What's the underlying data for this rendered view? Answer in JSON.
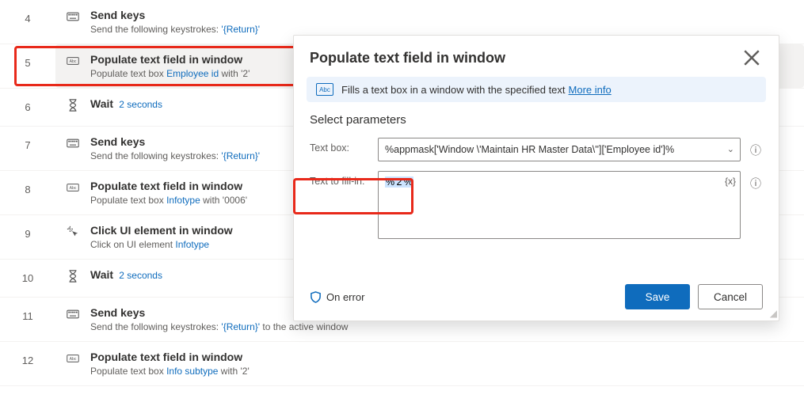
{
  "steps": [
    {
      "n": "4",
      "icon": "keyboard",
      "title": "Send keys",
      "sub_pre": "Send the following keystrokes: ",
      "sub_link": "'{Return}'",
      "sub_post": ""
    },
    {
      "n": "5",
      "icon": "abc",
      "title": "Populate text field in window",
      "sub_pre": "Populate text box ",
      "sub_link": "Employee id",
      "sub_post": " with '2'",
      "selected": true
    },
    {
      "n": "6",
      "icon": "hourglass",
      "title": "Wait",
      "inline_link": "2 seconds"
    },
    {
      "n": "7",
      "icon": "keyboard",
      "title": "Send keys",
      "sub_pre": "Send the following keystrokes: ",
      "sub_link": "'{Return}'",
      "sub_post": ""
    },
    {
      "n": "8",
      "icon": "abc",
      "title": "Populate text field in window",
      "sub_pre": "Populate text box ",
      "sub_link": "Infotype",
      "sub_post": " with '0006'"
    },
    {
      "n": "9",
      "icon": "click",
      "title": "Click UI element in window",
      "sub_pre": "Click on UI element ",
      "sub_link": "Infotype",
      "sub_post": ""
    },
    {
      "n": "10",
      "icon": "hourglass",
      "title": "Wait",
      "inline_link": "2 seconds"
    },
    {
      "n": "11",
      "icon": "keyboard",
      "title": "Send keys",
      "sub_pre": "Send the following keystrokes: ",
      "sub_link": "'{Return}'",
      "sub_post": " to the active window"
    },
    {
      "n": "12",
      "icon": "abc",
      "title": "Populate text field in window",
      "sub_pre": "Populate text box ",
      "sub_link": "Info subtype",
      "sub_post": " with '2'"
    }
  ],
  "panel": {
    "title": "Populate text field in window",
    "info_text": "Fills a text box in a window with the specified text",
    "info_link": "More info",
    "section_heading": "Select parameters",
    "textbox_label": "Text box:",
    "textbox_value": "%appmask['Window \\'Maintain HR Master Data\\'']['Employee id']%",
    "fill_label": "Text to fill-in:",
    "fill_value": "%'2'%",
    "var_glyph": "{x}",
    "on_error": "On error",
    "save": "Save",
    "cancel": "Cancel"
  }
}
